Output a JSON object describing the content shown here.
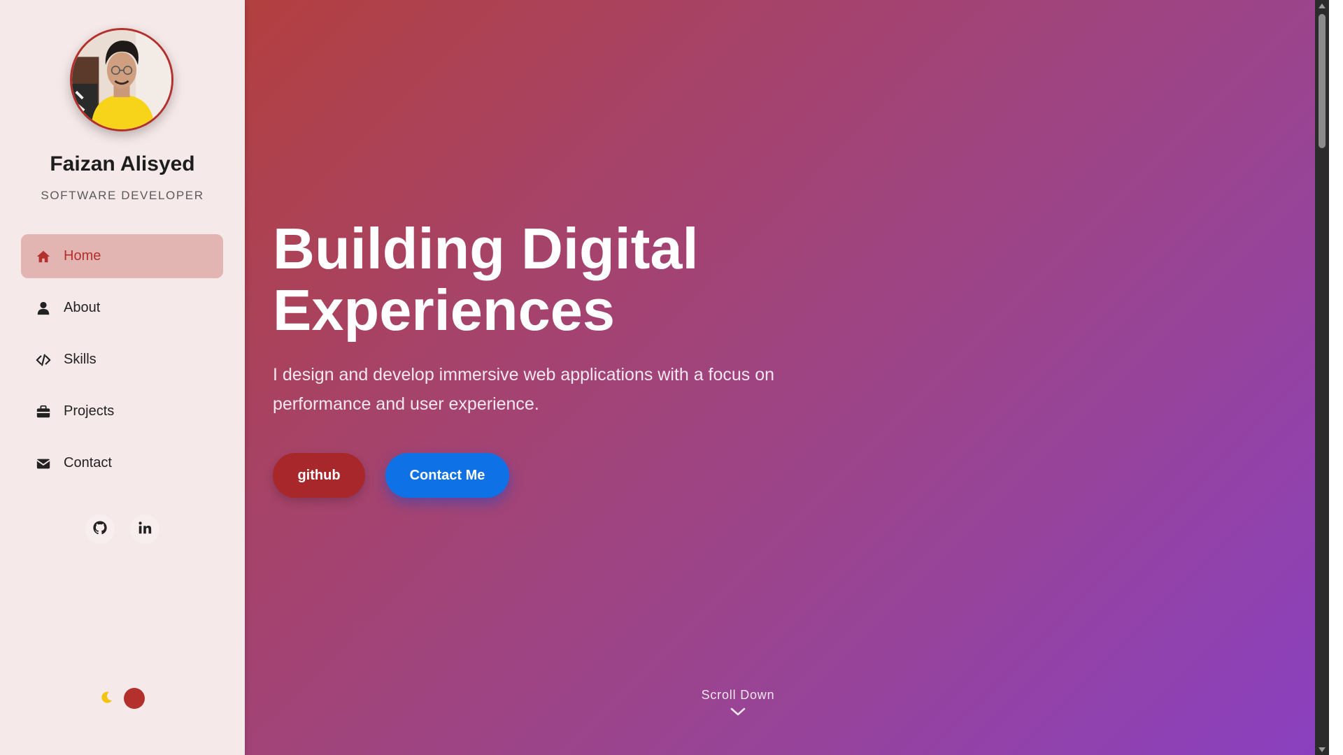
{
  "sidebar": {
    "profile": {
      "name": "Faizan Alisyed",
      "role": "SOFTWARE DEVELOPER"
    },
    "nav": [
      {
        "label": "Home",
        "icon": "home-icon",
        "active": true
      },
      {
        "label": "About",
        "icon": "user-icon",
        "active": false
      },
      {
        "label": "Skills",
        "icon": "code-icon",
        "active": false
      },
      {
        "label": "Projects",
        "icon": "briefcase-icon",
        "active": false
      },
      {
        "label": "Contact",
        "icon": "envelope-icon",
        "active": false
      }
    ],
    "social": [
      {
        "icon": "github-icon"
      },
      {
        "icon": "linkedin-icon"
      }
    ],
    "theme_toggle": {
      "icon": "moon-icon"
    }
  },
  "hero": {
    "title_line1": "Building Digital",
    "title_line2": "Experiences",
    "subtitle_line1": "I design and develop immersive web applications with a focus on",
    "subtitle_line2": "performance and user experience.",
    "buttons": {
      "github": "github",
      "contact": "Contact Me"
    },
    "scroll_label": "Scroll Down"
  },
  "colors": {
    "accent": "#b3302c",
    "sidebar_bg": "#f6e9e9",
    "active_nav_bg": "#e2b4b2",
    "primary_button": "#0e71e6",
    "github_button": "#a8272a",
    "moon": "#f1c40f",
    "gradient_start": "#b3403f",
    "gradient_end": "#8a40c0"
  }
}
